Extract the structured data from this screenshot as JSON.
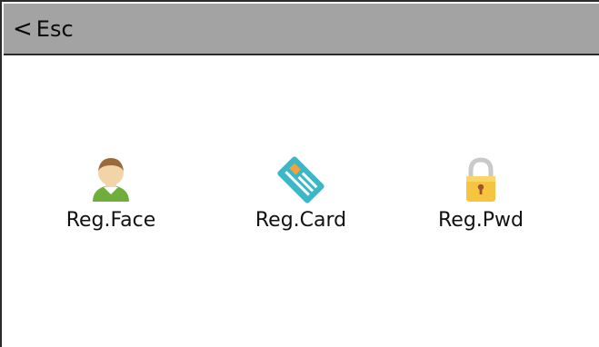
{
  "header": {
    "back_chevron": "<",
    "back_label": "Esc",
    "background_color": "#a3a3a3"
  },
  "menu": {
    "items": [
      {
        "label": "Reg.Face",
        "icon": "user-face-icon"
      },
      {
        "label": "Reg.Card",
        "icon": "id-card-icon"
      },
      {
        "label": "Reg.Pwd",
        "icon": "padlock-icon"
      }
    ]
  },
  "colors": {
    "face_skin": "#f3d3a8",
    "face_body": "#6fae3a",
    "card": "#3bb7c7",
    "card_chip": "#f2a23a",
    "lock_body": "#f5c542",
    "lock_shackle": "#c9c9c9"
  }
}
